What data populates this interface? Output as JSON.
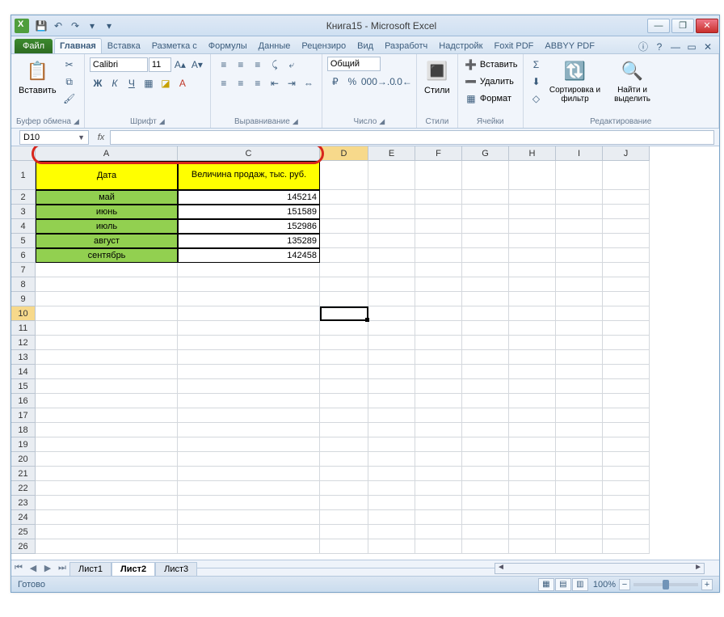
{
  "title": "Книга15  -  Microsoft Excel",
  "qat": {
    "save": "💾",
    "undo": "↶",
    "redo": "↷",
    "more1": "▾",
    "more2": "▾"
  },
  "win": {
    "min": "—",
    "max": "❐"
  },
  "tabs": {
    "file": "Файл",
    "items": [
      "Главная",
      "Вставка",
      "Разметка с",
      "Формулы",
      "Данные",
      "Рецензиро",
      "Вид",
      "Разработч",
      "Надстройк",
      "Foxit PDF",
      "ABBYY PDF"
    ],
    "active_index": 0
  },
  "help": {
    "h": "ⓘ",
    "q": "?",
    "m": "—",
    "r": "▭",
    "x": "✕"
  },
  "ribbon": {
    "clipboard": {
      "paste": "Вставить",
      "label": "Буфер обмена"
    },
    "font": {
      "name": "Calibri",
      "size": "11",
      "bold": "Ж",
      "italic": "К",
      "underline": "Ч",
      "border": "▦",
      "fill": "◪",
      "color": "A",
      "grow": "A▴",
      "shrink": "A▾",
      "label": "Шрифт"
    },
    "align": {
      "label": "Выравнивание",
      "wrap": "⤶",
      "merge": "⇔"
    },
    "number": {
      "format": "Общий",
      "label": "Число",
      "pct": "%",
      "comma": "000",
      "cur": "₽",
      "inc": "→.0",
      "dec": ".0←"
    },
    "styles": {
      "label": "Стили",
      "btn": "Стили",
      "cond": "▦"
    },
    "cells": {
      "insert": "Вставить",
      "delete": "Удалить",
      "format": "Формат",
      "label": "Ячейки"
    },
    "editing": {
      "sum": "Σ",
      "fill": "⬇",
      "clear": "◇",
      "sort": "Сортировка и фильтр",
      "find": "Найти и выделить",
      "label": "Редактирование"
    }
  },
  "formula_bar": {
    "name_box": "D10",
    "fx": "fx",
    "value": ""
  },
  "columns": [
    "A",
    "C",
    "D",
    "E",
    "F",
    "G",
    "H",
    "I",
    "J"
  ],
  "rows_visible": 26,
  "selected_row": 10,
  "selected_col_index": 2,
  "table": {
    "header": {
      "a": "Дата",
      "c": "Величина продаж, тыс. руб."
    },
    "rows": [
      {
        "a": "май",
        "c": "145214"
      },
      {
        "a": "июнь",
        "c": "151589"
      },
      {
        "a": "июль",
        "c": "152986"
      },
      {
        "a": "август",
        "c": "135289"
      },
      {
        "a": "сентябрь",
        "c": "142458"
      }
    ]
  },
  "sheet_tabs": {
    "items": [
      "Лист1",
      "Лист2",
      "Лист3"
    ],
    "active_index": 1
  },
  "status": {
    "ready": "Готово",
    "zoom": "100%"
  }
}
